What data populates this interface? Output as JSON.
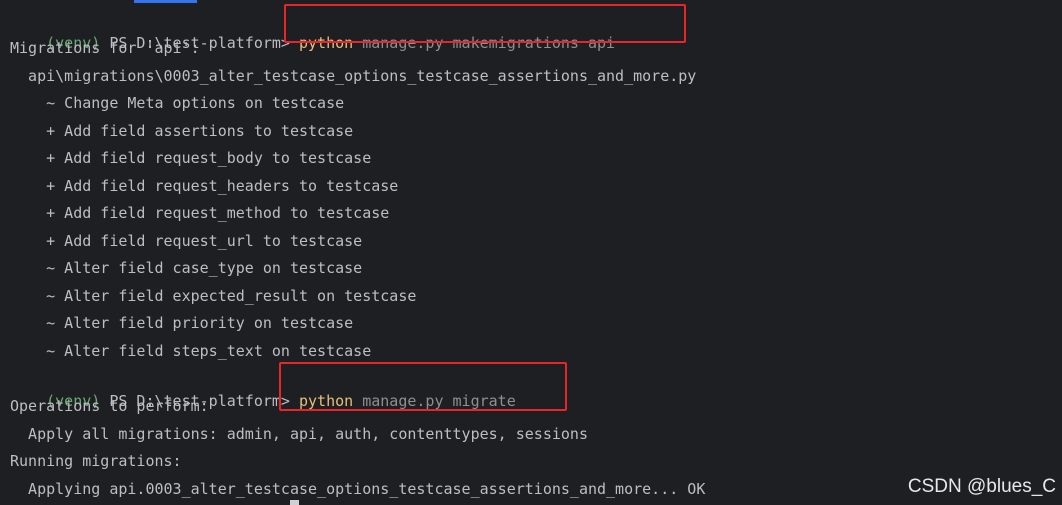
{
  "prompt": {
    "venv": "(venv)",
    "ps": " PS D:\\test-platform> "
  },
  "commands": [
    {
      "exe": "python",
      "args": " manage.py makemigrations api"
    },
    {
      "exe": "python",
      "args": " manage.py migrate"
    }
  ],
  "makemigrations_output": [
    "Migrations for 'api':",
    "  api\\migrations\\0003_alter_testcase_options_testcase_assertions_and_more.py",
    "    ~ Change Meta options on testcase",
    "    + Add field assertions to testcase",
    "    + Add field request_body to testcase",
    "    + Add field request_headers to testcase",
    "    + Add field request_method to testcase",
    "    + Add field request_url to testcase",
    "    ~ Alter field case_type on testcase",
    "    ~ Alter field expected_result on testcase",
    "    ~ Alter field priority on testcase",
    "    ~ Alter field steps_text on testcase"
  ],
  "migrate_output": [
    "Operations to perform:",
    "  Apply all migrations: admin, api, auth, contenttypes, sessions",
    "Running migrations:",
    "  Applying api.0003_alter_testcase_options_testcase_assertions_and_more... OK"
  ],
  "watermark": "CSDN @blues_C",
  "colors": {
    "background": "#1e1f22",
    "text": "#bcbec4",
    "venv": "#6aab73",
    "command": "#e5c07b",
    "args": "#8c8f94",
    "highlight_box": "#e8262a",
    "tab_indicator": "#3574f0"
  }
}
